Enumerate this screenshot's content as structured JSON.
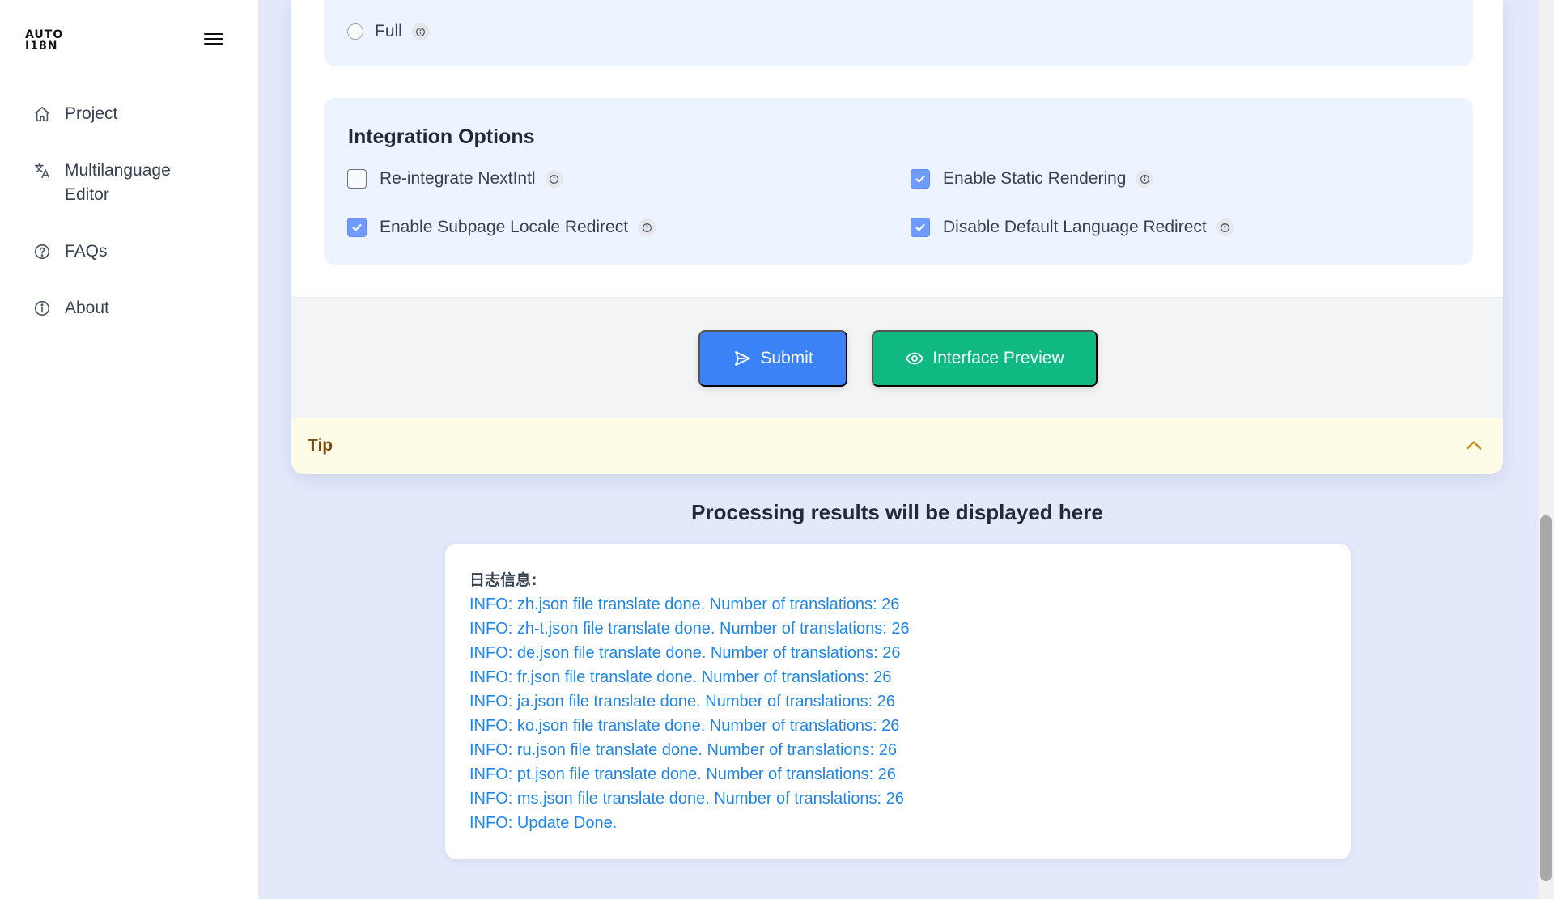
{
  "sidebar": {
    "logo_line1": "AUTO",
    "logo_line2": "I18N",
    "items": [
      {
        "label": "Project",
        "icon": "home-icon"
      },
      {
        "label": "Multilanguage Editor",
        "icon": "translate-icon"
      },
      {
        "label": "FAQs",
        "icon": "help-circle-icon"
      },
      {
        "label": "About",
        "icon": "info-circle-icon"
      }
    ]
  },
  "translation_mode": {
    "full_label": "Full"
  },
  "integration": {
    "title": "Integration Options",
    "options": [
      {
        "label": "Re-integrate NextIntl",
        "checked": false
      },
      {
        "label": "Enable Static Rendering",
        "checked": true
      },
      {
        "label": "Enable Subpage Locale Redirect",
        "checked": true
      },
      {
        "label": "Disable Default Language Redirect",
        "checked": true
      }
    ]
  },
  "actions": {
    "submit_label": "Submit",
    "preview_label": "Interface Preview"
  },
  "tip": {
    "label": "Tip"
  },
  "results": {
    "title": "Processing results will be displayed here",
    "log_header": "日志信息:",
    "lines": [
      "INFO: zh.json file translate done. Number of translations: 26",
      "INFO: zh-t.json file translate done. Number of translations: 26",
      "INFO: de.json file translate done. Number of translations: 26",
      "INFO: fr.json file translate done. Number of translations: 26",
      "INFO: ja.json file translate done. Number of translations: 26",
      "INFO: ko.json file translate done. Number of translations: 26",
      "INFO: ru.json file translate done. Number of translations: 26",
      "INFO: pt.json file translate done. Number of translations: 26",
      "INFO: ms.json file translate done. Number of translations: 26",
      "INFO: Update Done."
    ]
  },
  "colors": {
    "primary": "#3b82f6",
    "success": "#10b981",
    "log_text": "#1e86e8",
    "checkbox": "#6f9bff",
    "tip_bg": "#fefbe6"
  }
}
